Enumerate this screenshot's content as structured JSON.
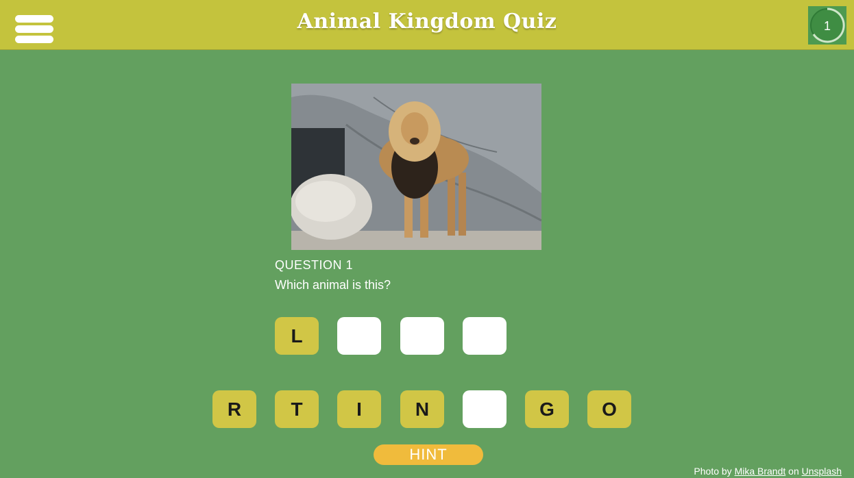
{
  "header": {
    "title": "Animal Kingdom Quiz",
    "menu_icon": "hamburger-menu-icon",
    "timer_value": "1",
    "background_color": "#c4c33d"
  },
  "question": {
    "label": "QUESTION 1",
    "text": "Which animal is this?"
  },
  "answer_slots": [
    "L",
    "",
    "",
    ""
  ],
  "letter_tiles": [
    "R",
    "T",
    "I",
    "N",
    "",
    "G",
    "O"
  ],
  "hint_label": "HINT",
  "credit": {
    "prefix": "Photo by",
    "author": "Mika Brandt",
    "middle": "on",
    "site": "Unsplash"
  },
  "colors": {
    "background": "#63a05f",
    "tile": "#d1c646",
    "hint": "#f0bb3c"
  }
}
